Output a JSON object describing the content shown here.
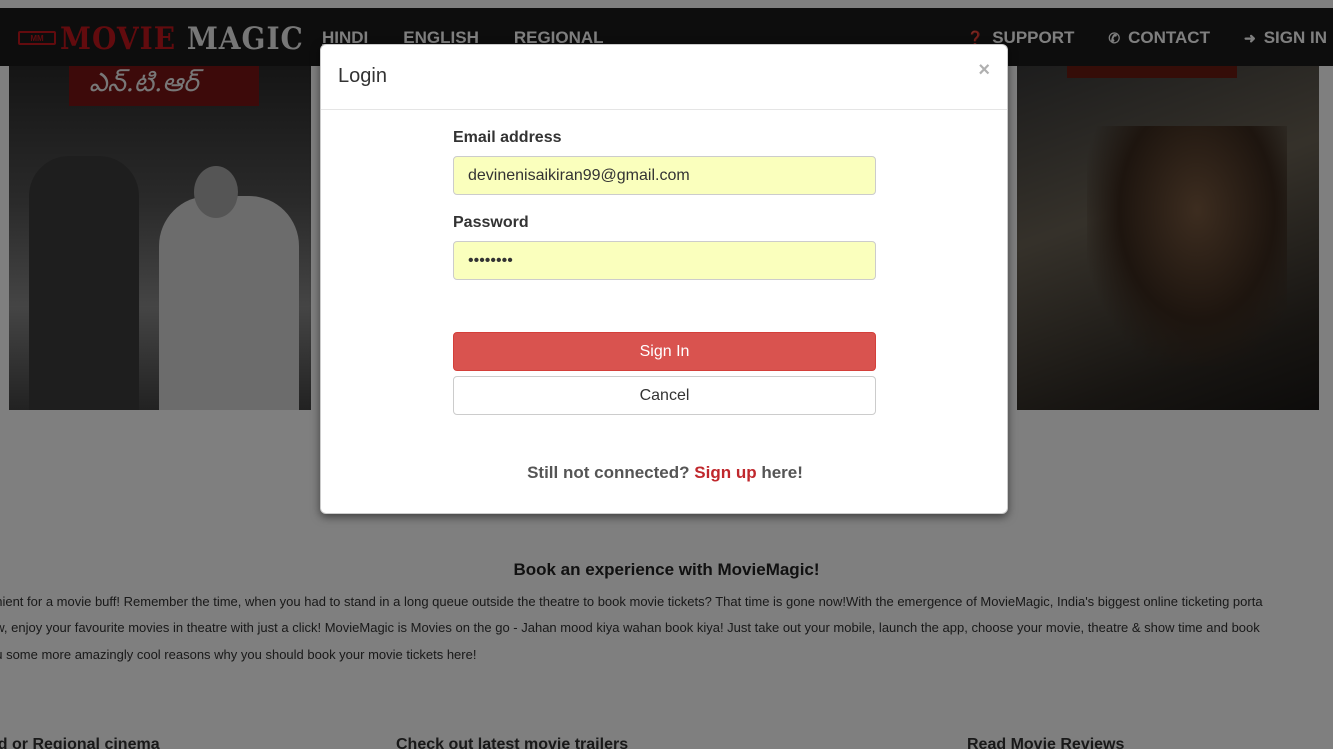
{
  "brand": {
    "badge": "MM",
    "word1": "MOVIE",
    "word2": "MAGIC"
  },
  "nav": {
    "left": [
      "HINDI",
      "ENGLISH",
      "REGIONAL"
    ],
    "support": "SUPPORT",
    "contact": "CONTACT",
    "signin": "SIGN IN"
  },
  "posters": {
    "left_title": "ఎన్.టి.ఆర్"
  },
  "content": {
    "title": "Book an experience with MovieMagic!",
    "lines": [
      "enient for a movie buff! Remember the time, when you had to stand in a long queue outside the theatre to book movie tickets? That time is gone now!With the emergence of MovieMagic, India's biggest online ticketing porta",
      "ow, enjoy your favourite movies in theatre with just a click! MovieMagic is Movies on the go - Jahan mood kiya wahan book kiya! Just take out your mobile, launch the app, choose your movie, theatre & show time and book",
      "ou some more amazingly cool reasons why you should book your movie tickets here!"
    ],
    "columns": [
      "od or Regional cinema",
      "Check out latest movie trailers",
      "Read Movie Reviews"
    ]
  },
  "modal": {
    "title": "Login",
    "close": "×",
    "email_label": "Email address",
    "email_value": "devinenisaikiran99@gmail.com",
    "password_label": "Password",
    "password_value": "••••••••",
    "signin_button": "Sign In",
    "cancel_button": "Cancel",
    "footer_prefix": "Still not connected?",
    "footer_link": "Sign up",
    "footer_suffix": "here!"
  }
}
